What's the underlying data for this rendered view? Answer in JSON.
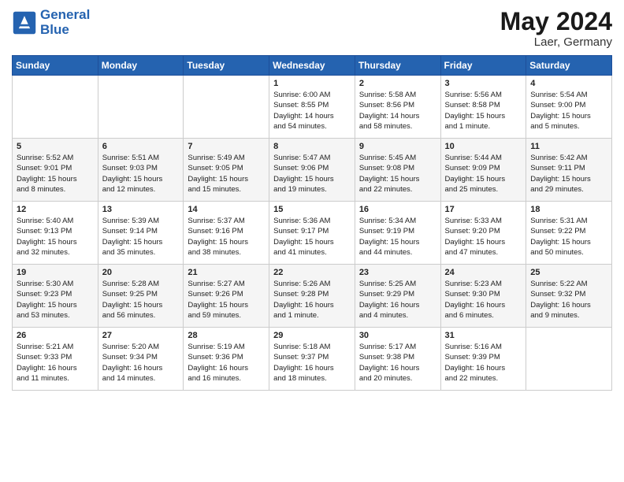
{
  "header": {
    "logo_line1": "General",
    "logo_line2": "Blue",
    "month_year": "May 2024",
    "location": "Laer, Germany"
  },
  "days_of_week": [
    "Sunday",
    "Monday",
    "Tuesday",
    "Wednesday",
    "Thursday",
    "Friday",
    "Saturday"
  ],
  "weeks": [
    [
      {
        "day": "",
        "info": ""
      },
      {
        "day": "",
        "info": ""
      },
      {
        "day": "",
        "info": ""
      },
      {
        "day": "1",
        "info": "Sunrise: 6:00 AM\nSunset: 8:55 PM\nDaylight: 14 hours\nand 54 minutes."
      },
      {
        "day": "2",
        "info": "Sunrise: 5:58 AM\nSunset: 8:56 PM\nDaylight: 14 hours\nand 58 minutes."
      },
      {
        "day": "3",
        "info": "Sunrise: 5:56 AM\nSunset: 8:58 PM\nDaylight: 15 hours\nand 1 minute."
      },
      {
        "day": "4",
        "info": "Sunrise: 5:54 AM\nSunset: 9:00 PM\nDaylight: 15 hours\nand 5 minutes."
      }
    ],
    [
      {
        "day": "5",
        "info": "Sunrise: 5:52 AM\nSunset: 9:01 PM\nDaylight: 15 hours\nand 8 minutes."
      },
      {
        "day": "6",
        "info": "Sunrise: 5:51 AM\nSunset: 9:03 PM\nDaylight: 15 hours\nand 12 minutes."
      },
      {
        "day": "7",
        "info": "Sunrise: 5:49 AM\nSunset: 9:05 PM\nDaylight: 15 hours\nand 15 minutes."
      },
      {
        "day": "8",
        "info": "Sunrise: 5:47 AM\nSunset: 9:06 PM\nDaylight: 15 hours\nand 19 minutes."
      },
      {
        "day": "9",
        "info": "Sunrise: 5:45 AM\nSunset: 9:08 PM\nDaylight: 15 hours\nand 22 minutes."
      },
      {
        "day": "10",
        "info": "Sunrise: 5:44 AM\nSunset: 9:09 PM\nDaylight: 15 hours\nand 25 minutes."
      },
      {
        "day": "11",
        "info": "Sunrise: 5:42 AM\nSunset: 9:11 PM\nDaylight: 15 hours\nand 29 minutes."
      }
    ],
    [
      {
        "day": "12",
        "info": "Sunrise: 5:40 AM\nSunset: 9:13 PM\nDaylight: 15 hours\nand 32 minutes."
      },
      {
        "day": "13",
        "info": "Sunrise: 5:39 AM\nSunset: 9:14 PM\nDaylight: 15 hours\nand 35 minutes."
      },
      {
        "day": "14",
        "info": "Sunrise: 5:37 AM\nSunset: 9:16 PM\nDaylight: 15 hours\nand 38 minutes."
      },
      {
        "day": "15",
        "info": "Sunrise: 5:36 AM\nSunset: 9:17 PM\nDaylight: 15 hours\nand 41 minutes."
      },
      {
        "day": "16",
        "info": "Sunrise: 5:34 AM\nSunset: 9:19 PM\nDaylight: 15 hours\nand 44 minutes."
      },
      {
        "day": "17",
        "info": "Sunrise: 5:33 AM\nSunset: 9:20 PM\nDaylight: 15 hours\nand 47 minutes."
      },
      {
        "day": "18",
        "info": "Sunrise: 5:31 AM\nSunset: 9:22 PM\nDaylight: 15 hours\nand 50 minutes."
      }
    ],
    [
      {
        "day": "19",
        "info": "Sunrise: 5:30 AM\nSunset: 9:23 PM\nDaylight: 15 hours\nand 53 minutes."
      },
      {
        "day": "20",
        "info": "Sunrise: 5:28 AM\nSunset: 9:25 PM\nDaylight: 15 hours\nand 56 minutes."
      },
      {
        "day": "21",
        "info": "Sunrise: 5:27 AM\nSunset: 9:26 PM\nDaylight: 15 hours\nand 59 minutes."
      },
      {
        "day": "22",
        "info": "Sunrise: 5:26 AM\nSunset: 9:28 PM\nDaylight: 16 hours\nand 1 minute."
      },
      {
        "day": "23",
        "info": "Sunrise: 5:25 AM\nSunset: 9:29 PM\nDaylight: 16 hours\nand 4 minutes."
      },
      {
        "day": "24",
        "info": "Sunrise: 5:23 AM\nSunset: 9:30 PM\nDaylight: 16 hours\nand 6 minutes."
      },
      {
        "day": "25",
        "info": "Sunrise: 5:22 AM\nSunset: 9:32 PM\nDaylight: 16 hours\nand 9 minutes."
      }
    ],
    [
      {
        "day": "26",
        "info": "Sunrise: 5:21 AM\nSunset: 9:33 PM\nDaylight: 16 hours\nand 11 minutes."
      },
      {
        "day": "27",
        "info": "Sunrise: 5:20 AM\nSunset: 9:34 PM\nDaylight: 16 hours\nand 14 minutes."
      },
      {
        "day": "28",
        "info": "Sunrise: 5:19 AM\nSunset: 9:36 PM\nDaylight: 16 hours\nand 16 minutes."
      },
      {
        "day": "29",
        "info": "Sunrise: 5:18 AM\nSunset: 9:37 PM\nDaylight: 16 hours\nand 18 minutes."
      },
      {
        "day": "30",
        "info": "Sunrise: 5:17 AM\nSunset: 9:38 PM\nDaylight: 16 hours\nand 20 minutes."
      },
      {
        "day": "31",
        "info": "Sunrise: 5:16 AM\nSunset: 9:39 PM\nDaylight: 16 hours\nand 22 minutes."
      },
      {
        "day": "",
        "info": ""
      }
    ]
  ]
}
